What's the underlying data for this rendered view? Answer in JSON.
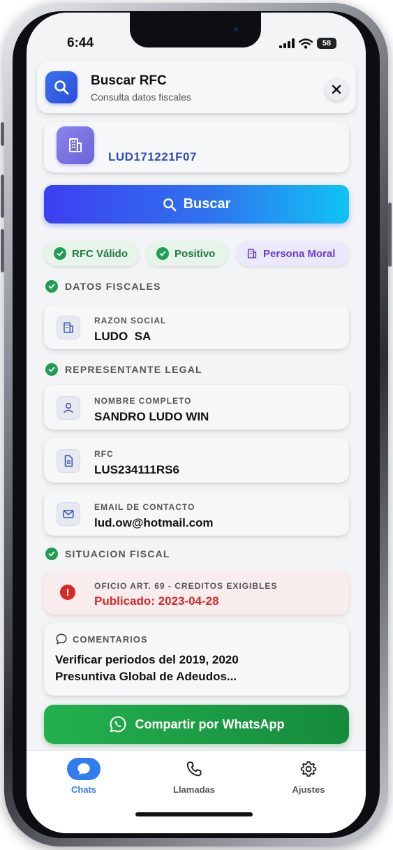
{
  "status_bar": {
    "time": "6:44",
    "battery": "58"
  },
  "header": {
    "title": "Buscar RFC",
    "subtitle": "Consulta datos fiscales",
    "close_symbol": "✕",
    "icon": "search-icon"
  },
  "rfc_input": {
    "value": "LUD171221F07",
    "icon": "building-icon"
  },
  "search_button": {
    "label": "Buscar",
    "icon": "search-icon"
  },
  "chips": [
    {
      "label": "RFC Válido",
      "icon": "check-circle-icon",
      "color": "#1f9d55"
    },
    {
      "label": "Positivo",
      "icon": "check-circle-icon",
      "color": "#1f9d55"
    },
    {
      "label": "Persona Moral",
      "icon": "building-icon",
      "color": "#6a3fd0"
    }
  ],
  "sections": {
    "fiscal": "DATOS FISCALES",
    "legal_rep": "REPRESENTANTE LEGAL",
    "tax_status": "SITUACION FISCAL"
  },
  "fiscal_data": {
    "label": "RAZON SOCIAL",
    "value": "LUDO  SA"
  },
  "legal_rep": {
    "name": {
      "label": "NOMBRE COMPLETO",
      "value": "SANDRO LUDO WIN"
    },
    "rfc": {
      "label": "RFC",
      "value": "LUS234111RS6"
    },
    "email": {
      "label": "EMAIL DE CONTACTO",
      "value": "lud.ow@hotmail.com"
    }
  },
  "tax_status": {
    "alert_label": "OFICIO ART. 69 - CREDITOS EXIGIBLES",
    "alert_value": "Publicado: 2023-04-28",
    "alert_icon_text": "!",
    "alert_color": "#d42a2a"
  },
  "comments": {
    "label": "COMENTARIOS",
    "line1": "Verificar periodos del 2019, 2020",
    "line2": "Presuntiva Global de Adeudos..."
  },
  "whatsapp_button": {
    "label": "Compartir por WhatsApp",
    "color": "#1ea246"
  },
  "tabs": [
    {
      "label": "Chats",
      "icon": "chat-bubble-icon",
      "active": true
    },
    {
      "label": "Llamadas",
      "icon": "phone-icon",
      "active": false
    },
    {
      "label": "Ajustes",
      "icon": "gear-icon",
      "active": false
    }
  ],
  "accent_color": "#2f7df0"
}
